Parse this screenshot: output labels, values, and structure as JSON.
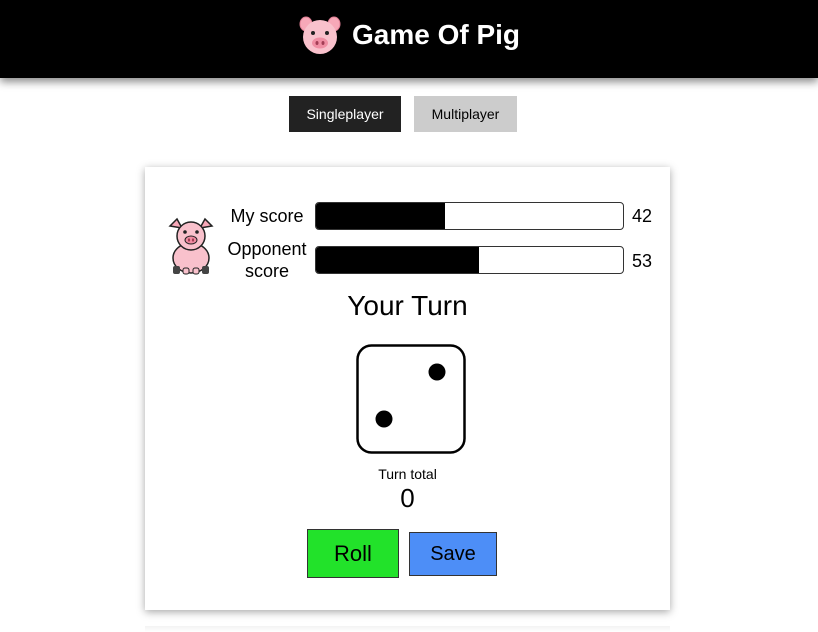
{
  "header": {
    "title": "Game Of Pig",
    "logo_icon": "pig-face-icon"
  },
  "modes": {
    "singleplayer_label": "Singleplayer",
    "multiplayer_label": "Multiplayer",
    "selected": "Singleplayer"
  },
  "game": {
    "avatar_icon": "pig-sitting-icon",
    "my_score": {
      "label": "My score",
      "value": "42",
      "fill_percent": 42
    },
    "opponent_score": {
      "label_line1": "Opponent",
      "label_line2": "score",
      "value": "53",
      "fill_percent": 53
    },
    "turn_status": "Your Turn",
    "die": {
      "face_value": 2,
      "icon": "die-face-two-icon"
    },
    "turn_total_label": "Turn total",
    "turn_total_value": "0",
    "roll_label": "Roll",
    "save_label": "Save"
  },
  "colors": {
    "header_bg": "#000000",
    "active_tab_bg": "#222222",
    "inactive_tab_bg": "#cccccc",
    "roll_button": "#22e22a",
    "save_button": "#4d8ef7",
    "score_fill": "#000000"
  }
}
